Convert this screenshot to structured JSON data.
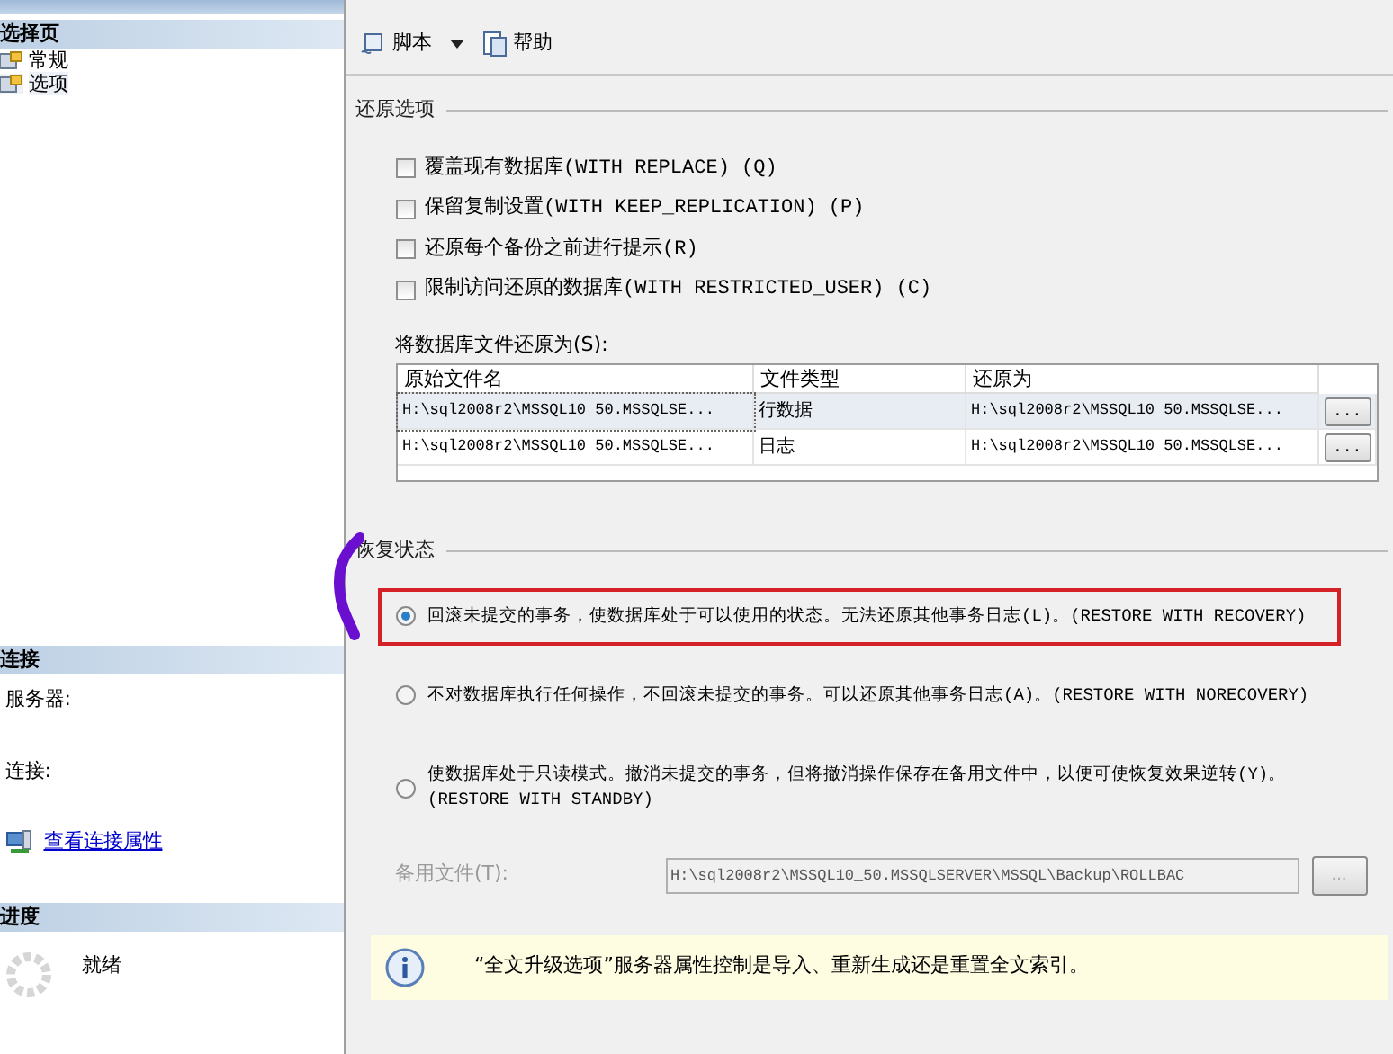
{
  "sidebar": {
    "pages_header": "选择页",
    "pages": [
      {
        "label": "常规",
        "selected": false
      },
      {
        "label": "选项",
        "selected": true
      }
    ],
    "connection_header": "连接",
    "server_label": "服务器:",
    "connection_label": "连接:",
    "connection_link": "查看连接属性",
    "progress_header": "进度",
    "progress_status": "就绪"
  },
  "toolbar": [
    {
      "label": "脚本",
      "kind": "dropdown"
    },
    {
      "label": "帮助",
      "kind": "button"
    }
  ],
  "restore_options": {
    "title": "还原选项",
    "options": [
      {
        "label": "覆盖现有数据库(WITH REPLACE) (Q)",
        "checked": false
      },
      {
        "label": "保留复制设置(WITH KEEP_REPLICATION) (P)",
        "checked": false
      },
      {
        "label": "还原每个备份之前进行提示(R)",
        "checked": false
      },
      {
        "label": "限制访问还原的数据库(WITH RESTRICTED_USER) (C)",
        "checked": false
      }
    ],
    "files_label": "将数据库文件还原为(S):",
    "columns": [
      "原始文件名",
      "文件类型",
      "还原为"
    ],
    "rows": [
      {
        "cells": [
          "H:\\sql2008r2\\MSSQL10_50.MSSQLSE...",
          "行数据",
          "H:\\sql2008r2\\MSSQL10_50.MSSQLSE..."
        ],
        "button": "...",
        "selected": true
      },
      {
        "cells": [
          "H:\\sql2008r2\\MSSQL10_50.MSSQLSE...",
          "日志",
          "H:\\sql2008r2\\MSSQL10_50.MSSQLSE..."
        ],
        "button": "...",
        "selected": false
      }
    ]
  },
  "recovery_state": {
    "title": "恢复状态",
    "options": [
      {
        "label": "回滚未提交的事务，使数据库处于可以使用的状态。无法还原其他事务日志(L)。(RESTORE WITH RECOVERY)",
        "selected": true,
        "highlighted": true
      },
      {
        "label": "不对数据库执行任何操作，不回滚未提交的事务。可以还原其他事务日志(A)。(RESTORE WITH NORECOVERY)",
        "selected": false,
        "highlighted": false
      },
      {
        "label": "使数据库处于只读模式。撤消未提交的事务，但将撤消操作保存在备用文件中，以便可使恢复效果逆转(Y)。(RESTORE WITH STANDBY)",
        "selected": false,
        "highlighted": false
      }
    ],
    "standby_label": "备用文件(T):",
    "standby_value": "H:\\sql2008r2\\MSSQL10_50.MSSQLSERVER\\MSSQL\\Backup\\ROLLBAC",
    "standby_button": "...",
    "standby_disabled": true
  },
  "info": {
    "text": "“全文升级选项”服务器属性控制是导入、重新生成还是重置全文索引。"
  }
}
